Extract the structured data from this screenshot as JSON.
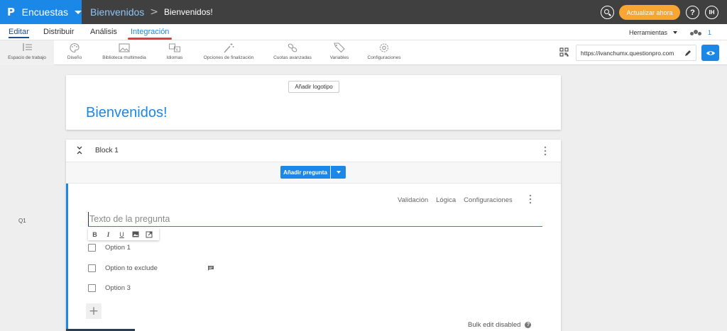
{
  "app": {
    "title": "Encuestas",
    "logo": "P"
  },
  "breadcrumb": {
    "parent": "Bienvenidos",
    "separator": ">",
    "current": "Bienvenidos!"
  },
  "header": {
    "upgrade_label": "Actualizar ahora",
    "help_label": "?",
    "avatar_initials": "IH"
  },
  "nav": {
    "tabs": [
      {
        "label": "Editar"
      },
      {
        "label": "Distribuir"
      },
      {
        "label": "Análisis"
      },
      {
        "label": "Integración"
      }
    ],
    "tools_label": "Herramientas",
    "collaborators_count": "1"
  },
  "toolbar": {
    "items": [
      {
        "label": "Espacio de trabajo",
        "icon": "workspace-icon"
      },
      {
        "label": "Diseño",
        "icon": "palette-icon"
      },
      {
        "label": "Biblioteca multimedia",
        "icon": "image-icon"
      },
      {
        "label": "Idiomas",
        "icon": "translate-icon"
      },
      {
        "label": "Opciones de finalización",
        "icon": "magic-wand-icon"
      },
      {
        "label": "Cuotas avanzadas",
        "icon": "link-icon"
      },
      {
        "label": "Variables",
        "icon": "tag-icon"
      },
      {
        "label": "Configuraciones",
        "icon": "gear-icon"
      }
    ],
    "survey_url": "https://ivanchumx.questionpro.com"
  },
  "welcome": {
    "add_logo_label": "Añadir logotipo",
    "title": "Bienvenidos!"
  },
  "block": {
    "title": "Block 1",
    "add_question_label": "Añadir pregunta"
  },
  "question": {
    "number": "Q1",
    "actions": [
      "Validación",
      "Lógica",
      "Configuraciones"
    ],
    "placeholder": "Texto de la pregunta",
    "format_buttons": [
      "B",
      "I",
      "U"
    ],
    "options": [
      "Option 1",
      "Option to exclude",
      "Option 3"
    ],
    "add_option_label": "+",
    "bulk_edit_label": "Bulk edit disabled"
  },
  "colors": {
    "brand": "#1b87e6",
    "topbar": "#404040",
    "upgrade": "#f8a531",
    "highlight": "#e23b3b"
  }
}
